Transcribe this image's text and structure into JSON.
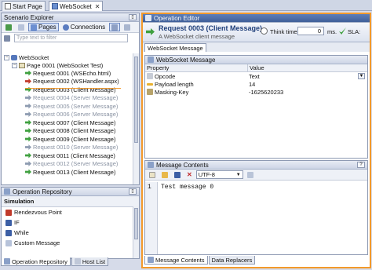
{
  "doc_tabs": [
    {
      "label": "Start Page",
      "active": false
    },
    {
      "label": "WebSocket",
      "active": true
    }
  ],
  "scenario_explorer": {
    "title": "Scenario Explorer",
    "toolbar": {
      "pages_label": "Pages",
      "connections_label": "Connections"
    },
    "filter_placeholder": "Type text to filter",
    "tree": {
      "root": "WebSocket",
      "page": "Page 0001 (WebSocket Test)",
      "items": [
        {
          "label": "Request 0001 (WSEcho.html)",
          "kind": "normal"
        },
        {
          "label": "Request 0002 (WSHandler.aspx)",
          "kind": "red"
        },
        {
          "label": "Request 0003 (Client Message)",
          "kind": "normal"
        },
        {
          "label": "Request 0004 (Server Message)",
          "kind": "server"
        },
        {
          "label": "Request 0005 (Server Message)",
          "kind": "server"
        },
        {
          "label": "Request 0006 (Server Message)",
          "kind": "server"
        },
        {
          "label": "Request 0007 (Client Message)",
          "kind": "normal"
        },
        {
          "label": "Request 0008 (Client Message)",
          "kind": "normal"
        },
        {
          "label": "Request 0009 (Client Message)",
          "kind": "normal"
        },
        {
          "label": "Request 0010 (Server Message)",
          "kind": "server"
        },
        {
          "label": "Request 0011 (Client Message)",
          "kind": "normal"
        },
        {
          "label": "Request 0012 (Server Message)",
          "kind": "server"
        },
        {
          "label": "Request 0013 (Client Message)",
          "kind": "normal"
        }
      ]
    }
  },
  "operation_repository": {
    "title": "Operation Repository",
    "group": "Simulation",
    "items": [
      "Rendezvous Point",
      "IF",
      "While",
      "Custom Message"
    ],
    "tabs": [
      "Operation Repository",
      "Host List"
    ]
  },
  "operation_editor": {
    "title": "Operation Editor",
    "request_title": "Request 0003 (Client Message)",
    "subtitle": "A WebSocket client message",
    "think_time_label": "Think time:",
    "think_time_value": "0",
    "think_time_unit": "ms.",
    "sla_label": "SLA:"
  },
  "websocket_message": {
    "tab": "WebSocket Message",
    "panel_title": "WebSocket Message",
    "columns": [
      "Property",
      "Value"
    ],
    "rows": [
      {
        "property": "Opcode",
        "value": "Text"
      },
      {
        "property": "Payload length",
        "value": "14"
      },
      {
        "property": "Masking-Key",
        "value": "-1625620233"
      }
    ]
  },
  "message_contents": {
    "title": "Message Contents",
    "encoding": "UTF-8",
    "line_number": "1",
    "text": "Test message 0",
    "tabs": [
      "Message Contents",
      "Data Replacers"
    ]
  },
  "colors": {
    "accent_orange": "#f39a2b",
    "title_blue": "#1f3f7a",
    "client_arrow": "#3fa03f",
    "server_arrow": "#8d9bb0"
  }
}
